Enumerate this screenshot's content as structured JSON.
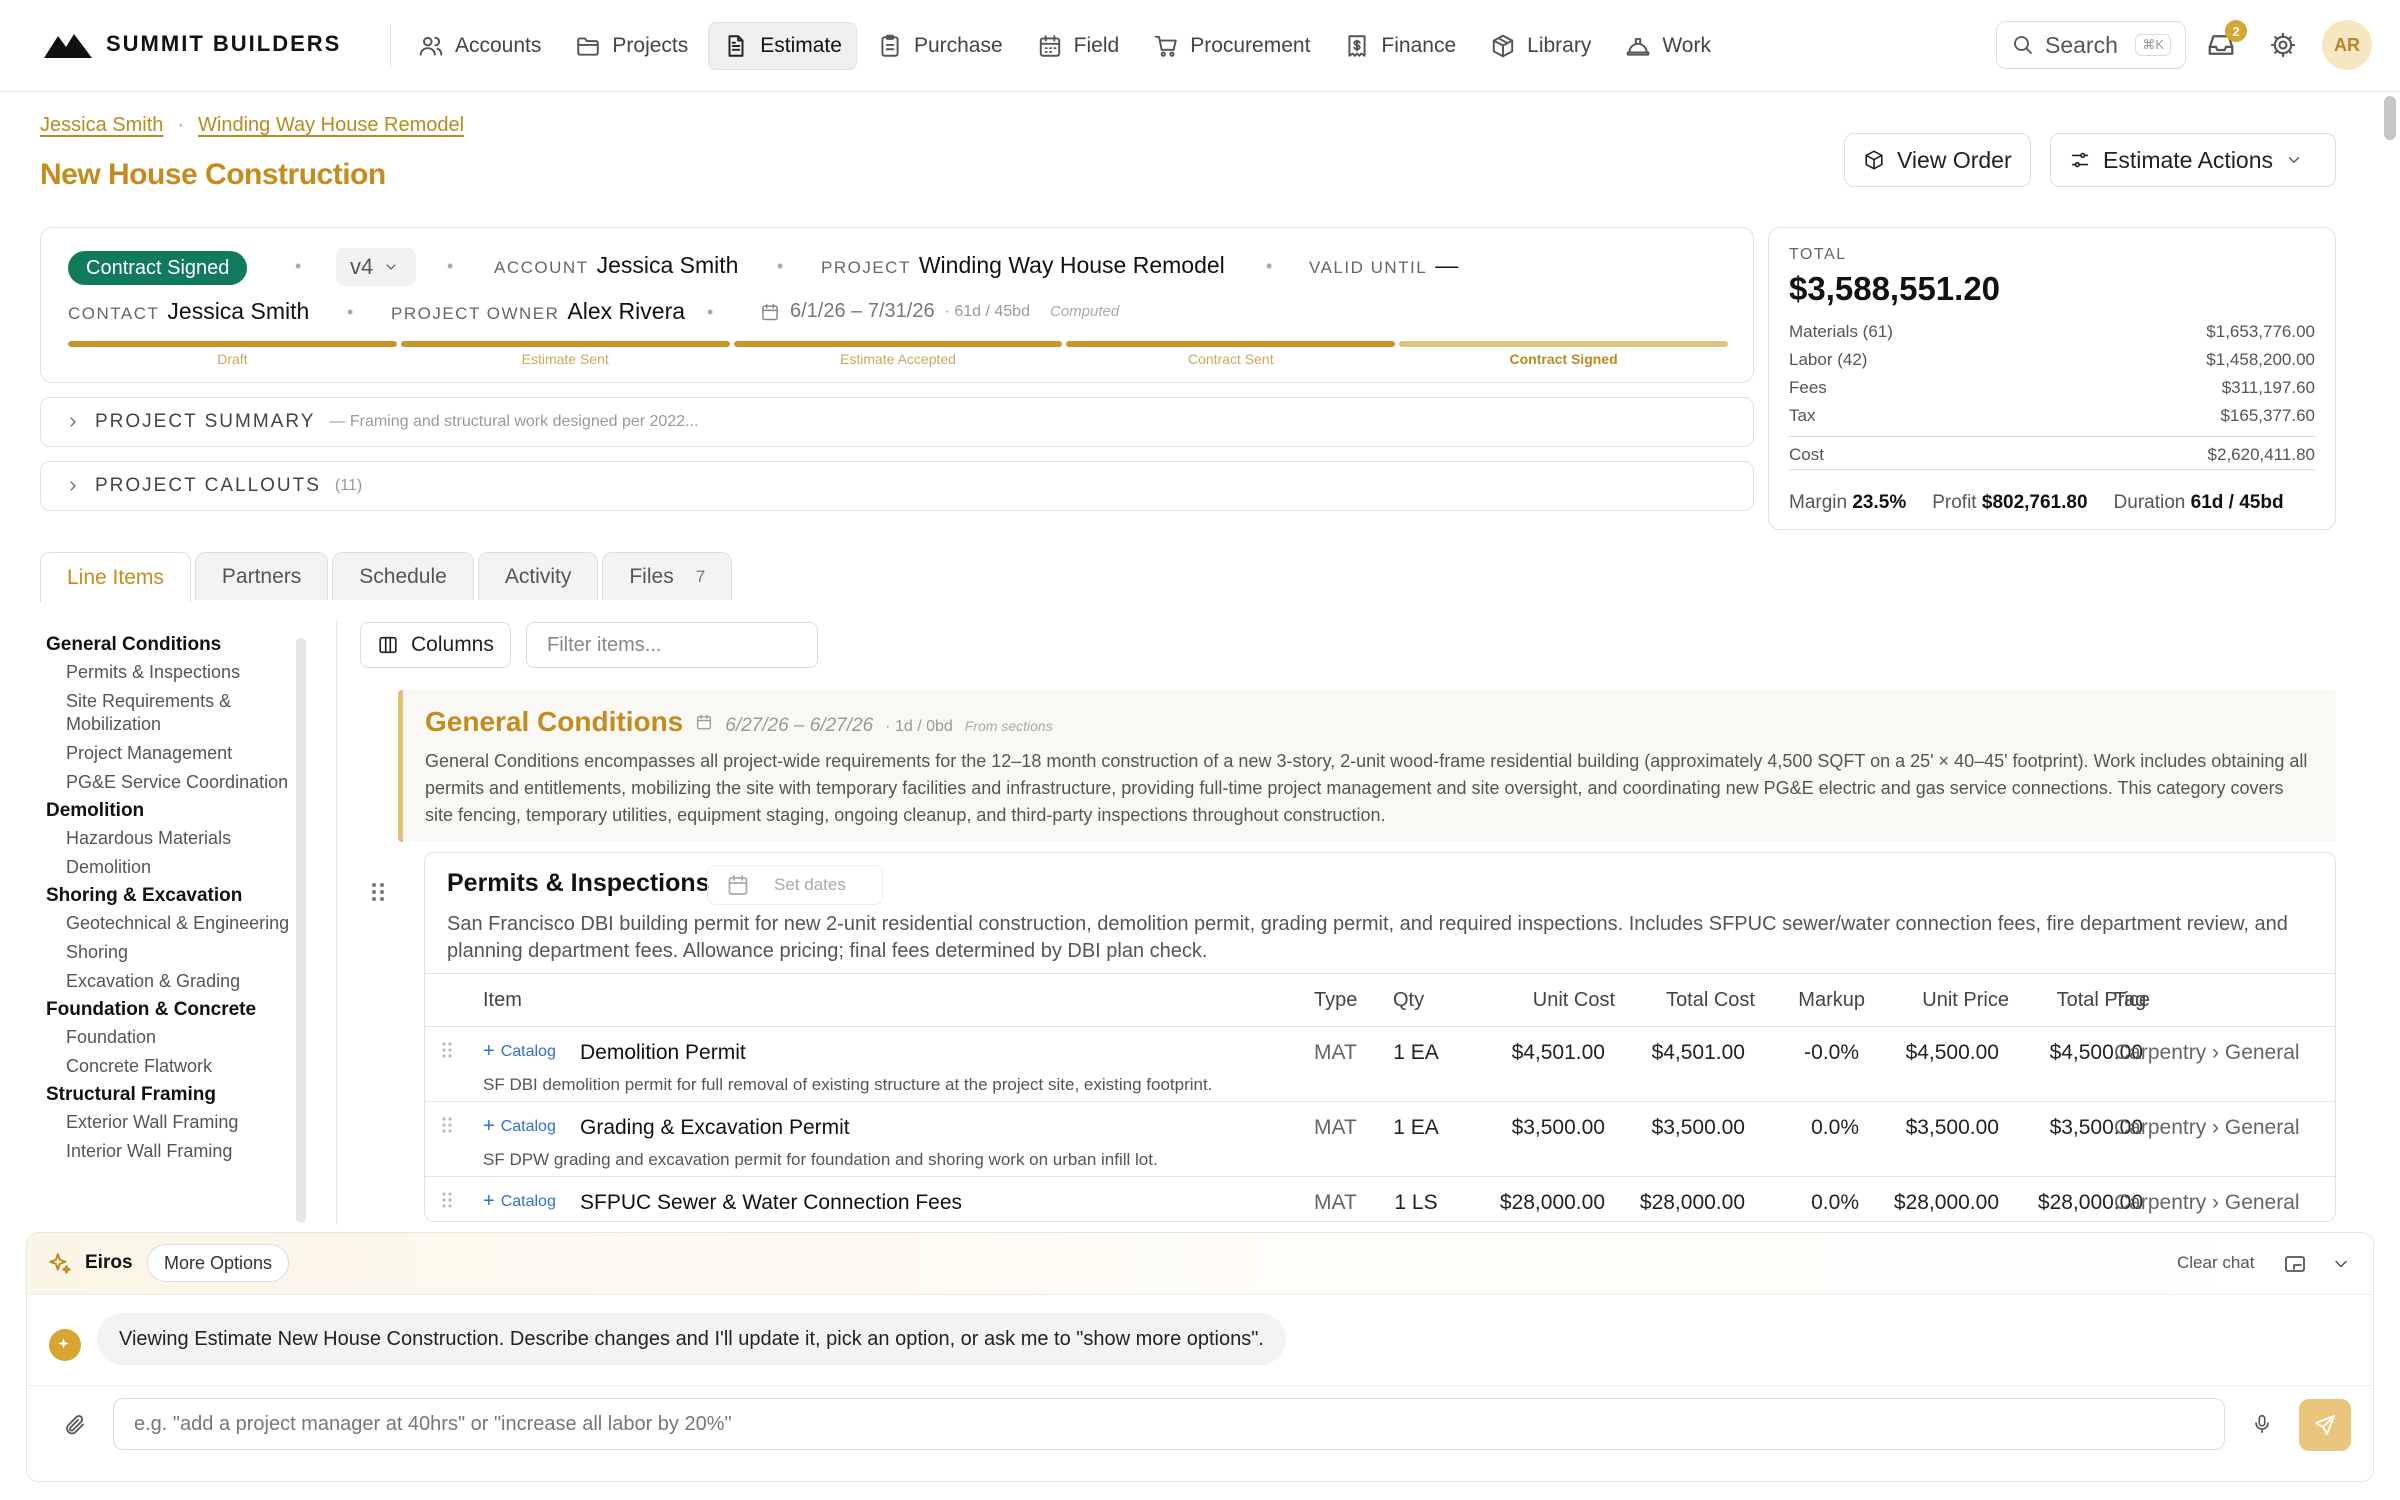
{
  "brand": {
    "name": "SUMMIT BUILDERS"
  },
  "nav": {
    "items": [
      {
        "label": "Accounts",
        "icon": "users-icon"
      },
      {
        "label": "Projects",
        "icon": "folder-icon"
      },
      {
        "label": "Estimate",
        "icon": "document-icon",
        "active": true
      },
      {
        "label": "Purchase",
        "icon": "clipboard-icon"
      },
      {
        "label": "Field",
        "icon": "calendar-icon"
      },
      {
        "label": "Procurement",
        "icon": "cart-icon"
      },
      {
        "label": "Finance",
        "icon": "receipt-icon"
      },
      {
        "label": "Library",
        "icon": "box-icon"
      },
      {
        "label": "Work",
        "icon": "hardhat-icon"
      }
    ],
    "search_label": "Search",
    "search_shortcut": "⌘K",
    "inbox_count": "2",
    "avatar_initials": "AR"
  },
  "breadcrumb": {
    "account": "Jessica Smith",
    "project": "Winding Way House Remodel"
  },
  "page_title": "New House Construction",
  "actions": {
    "view_order": "View Order",
    "estimate_actions": "Estimate Actions"
  },
  "info": {
    "status": "Contract Signed",
    "version": "v4",
    "account_label": "ACCOUNT",
    "account": "Jessica Smith",
    "project_label": "PROJECT",
    "project": "Winding Way House Remodel",
    "valid_label": "VALID UNTIL",
    "valid": "—",
    "contact_label": "CONTACT",
    "contact": "Jessica Smith",
    "owner_label": "PROJECT OWNER",
    "owner": "Alex Rivera",
    "dates": "6/1/26 – 7/31/26",
    "duration": "· 61d / 45bd",
    "computed": "Computed",
    "stages": [
      "Draft",
      "Estimate Sent",
      "Estimate Accepted",
      "Contract Sent",
      "Contract Signed"
    ]
  },
  "summary": {
    "label": "PROJECT SUMMARY",
    "preview": "— Framing and structural work designed per 2022..."
  },
  "callouts": {
    "label": "PROJECT CALLOUTS",
    "count": "(11)"
  },
  "totals": {
    "label": "TOTAL",
    "amount": "$3,588,551.20",
    "rows": [
      {
        "label": "Materials (61)",
        "value": "$1,653,776.00"
      },
      {
        "label": "Labor (42)",
        "value": "$1,458,200.00"
      },
      {
        "label": "Fees",
        "value": "$311,197.60"
      },
      {
        "label": "Tax",
        "value": "$165,377.60"
      }
    ],
    "cost_label": "Cost",
    "cost": "$2,620,411.80",
    "margin_label": "Margin",
    "margin": "23.5%",
    "profit_label": "Profit",
    "profit": "$802,761.80",
    "duration_label": "Duration",
    "duration": "61d / 45bd"
  },
  "tabs": [
    {
      "label": "Line Items",
      "active": true
    },
    {
      "label": "Partners"
    },
    {
      "label": "Schedule"
    },
    {
      "label": "Activity"
    },
    {
      "label": "Files",
      "count": "7"
    }
  ],
  "outline": [
    {
      "category": "General Conditions",
      "items": [
        "Permits & Inspections",
        "Site Requirements & Mobilization",
        "Project Management",
        "PG&E Service Coordination"
      ]
    },
    {
      "category": "Demolition",
      "items": [
        "Hazardous Materials",
        "Demolition"
      ]
    },
    {
      "category": "Shoring & Excavation",
      "items": [
        "Geotechnical & Engineering",
        "Shoring",
        "Excavation & Grading"
      ]
    },
    {
      "category": "Foundation & Concrete",
      "items": [
        "Foundation",
        "Concrete Flatwork"
      ]
    },
    {
      "category": "Structural Framing",
      "items": [
        "Exterior Wall Framing",
        "Interior Wall Framing"
      ]
    }
  ],
  "toolbar": {
    "columns": "Columns",
    "filter_placeholder": "Filter items..."
  },
  "general_conditions": {
    "title": "General Conditions",
    "dates": "6/27/26 – 6/27/26",
    "meta": "· 1d / 0bd",
    "source": "From sections",
    "description": "General Conditions encompasses all project-wide requirements for the 12–18 month construction of a new 3-story, 2-unit wood-frame residential building (approximately 4,500 SQFT on a 25' × 40–45' footprint). Work includes obtaining all permits and entitlements, mobilizing the site with temporary facilities and infrastructure, providing full-time project management and site oversight, and coordinating new PG&E electric and gas service connections. This category covers site fencing, temporary utilities, equipment staging, ongoing cleanup, and third-party inspections throughout construction."
  },
  "section": {
    "title": "Permits & Inspections",
    "set_dates": "Set dates",
    "description": "San Francisco DBI building permit for new 2-unit residential construction, demolition permit, grading permit, and required inspections. Includes SFPUC sewer/water connection fees, fire department review, and planning department fees. Allowance pricing; final fees determined by DBI plan check.",
    "columns": [
      "Item",
      "Type",
      "Qty",
      "Unit Cost",
      "Total Cost",
      "Markup",
      "Unit Price",
      "Total Price",
      "Tag"
    ],
    "catalog_label": "Catalog",
    "rows": [
      {
        "name": "Demolition Permit",
        "type": "MAT",
        "qty": "1 EA",
        "unit_cost": "$4,501.00",
        "total_cost": "$4,501.00",
        "markup": "-0.0%",
        "unit_price": "$4,500.00",
        "total_price": "$4,500.00",
        "tag": "Carpentry › General",
        "desc": "SF DBI demolition permit for full removal of existing structure at the project site, existing footprint."
      },
      {
        "name": "Grading & Excavation Permit",
        "type": "MAT",
        "qty": "1 EA",
        "unit_cost": "$3,500.00",
        "total_cost": "$3,500.00",
        "markup": "0.0%",
        "unit_price": "$3,500.00",
        "total_price": "$3,500.00",
        "tag": "Carpentry › General",
        "desc": "SF DPW grading and excavation permit for foundation and shoring work on urban infill lot."
      },
      {
        "name": "SFPUC Sewer & Water Connection Fees",
        "type": "MAT",
        "qty": "1 LS",
        "unit_cost": "$28,000.00",
        "total_cost": "$28,000.00",
        "markup": "0.0%",
        "unit_price": "$28,000.00",
        "total_price": "$28,000.00",
        "tag": "Carpentry › General",
        "desc": ""
      }
    ]
  },
  "chat": {
    "name": "Eiros",
    "more_options": "More Options",
    "clear": "Clear chat",
    "message": "Viewing Estimate New House Construction. Describe changes and I'll update it, pick an option, or ask me to \"show more options\".",
    "placeholder": "e.g. \"add a project manager at 40hrs\" or \"increase all labor by 20%\""
  },
  "colors": {
    "accent": "#c38c1d",
    "status_green": "#117a5a",
    "link_blue": "#2f6fce"
  }
}
